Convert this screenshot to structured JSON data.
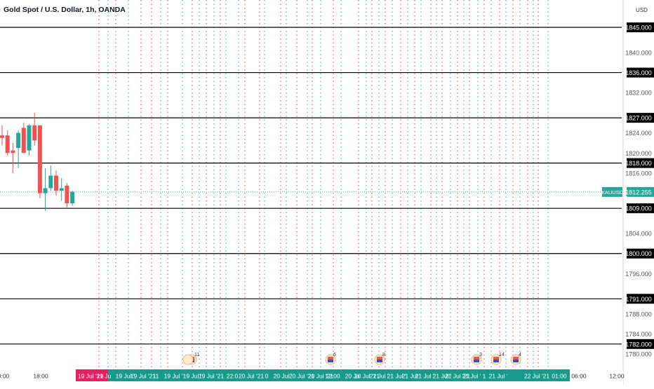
{
  "header": {
    "symbol_title": "Gold Spot / U.S. Dollar, 1h, OANDA",
    "currency": "USD"
  },
  "colors": {
    "up": "#26a69a",
    "down": "#ef5350",
    "red_line": "#e53935",
    "green_line": "#26a69a",
    "bar_green": "#199b8c",
    "bar_red": "#e91e63",
    "level_line": "#000000",
    "axis_text": "#555555"
  },
  "price_tag": {
    "symbol": "XAUUSD",
    "price": "1812.255",
    "value": 1812.255
  },
  "chart_data": {
    "type": "candlestick",
    "y_axis": {
      "range": [
        1778.5,
        1848.0
      ],
      "ticks": [
        1780,
        1784,
        1788,
        1792,
        1796,
        1800,
        1804,
        1808,
        1812,
        1816,
        1820,
        1824,
        1828,
        1832,
        1836,
        1840,
        1844
      ],
      "tick_labels": [
        "1780.000",
        "1784.000",
        "1788.000",
        "1792.000",
        "1796.000",
        "1800.000",
        "1804.000",
        "1808.000",
        "1812.000",
        "1816.000",
        "1820.000",
        "1824.000",
        "1828.000",
        "1832.000",
        "1836.000",
        "1840.000",
        "1844.000"
      ]
    },
    "levels": [
      {
        "value": 1845,
        "label": "1845.000"
      },
      {
        "value": 1836,
        "label": "1836.000"
      },
      {
        "value": 1827,
        "label": "1827.000"
      },
      {
        "value": 1818,
        "label": "1818.000"
      },
      {
        "value": 1809,
        "label": "1809.000"
      },
      {
        "value": 1800,
        "label": "1800.000"
      },
      {
        "value": 1791,
        "label": "1791.000"
      },
      {
        "value": 1782,
        "label": "1782.000"
      }
    ],
    "candles": [
      {
        "o": 1823.5,
        "h": 1825.5,
        "l": 1821.5,
        "c": 1823.0
      },
      {
        "o": 1823.5,
        "h": 1824.5,
        "l": 1819.5,
        "c": 1820.0
      },
      {
        "o": 1820.5,
        "h": 1822.0,
        "l": 1816.0,
        "c": 1820.0
      },
      {
        "o": 1821.0,
        "h": 1824.5,
        "l": 1817.0,
        "c": 1824.0
      },
      {
        "o": 1825.0,
        "h": 1826.0,
        "l": 1820.0,
        "c": 1820.0
      },
      {
        "o": 1820.5,
        "h": 1825.8,
        "l": 1819.5,
        "c": 1825.5
      },
      {
        "o": 1825.5,
        "h": 1828.0,
        "l": 1821.5,
        "c": 1822.5
      },
      {
        "o": 1825.5,
        "h": 1825.5,
        "l": 1811.0,
        "c": 1812.0
      },
      {
        "o": 1812.0,
        "h": 1817.0,
        "l": 1808.5,
        "c": 1813.0
      },
      {
        "o": 1813.0,
        "h": 1817.5,
        "l": 1812.5,
        "c": 1815.5
      },
      {
        "o": 1815.5,
        "h": 1816.5,
        "l": 1811.5,
        "c": 1812.5
      },
      {
        "o": 1812.5,
        "h": 1815.0,
        "l": 1810.5,
        "c": 1813.0
      },
      {
        "o": 1813.5,
        "h": 1814.0,
        "l": 1809.0,
        "c": 1810.0
      },
      {
        "o": 1810.0,
        "h": 1812.5,
        "l": 1809.5,
        "c": 1812.3
      }
    ],
    "time_labels": [
      {
        "text": "0:00",
        "kind": "plain"
      },
      {
        "text": "18:00",
        "kind": "plain"
      },
      {
        "text": "19 Jul '21",
        "kind": "red"
      },
      {
        "text": "19 Ju",
        "kind": "green"
      },
      {
        "text": "19 Jul '",
        "kind": "green"
      },
      {
        "text": "19 Jul '21",
        "kind": "green"
      },
      {
        "text": "11",
        "kind": "green"
      },
      {
        "text": "19 Jul '",
        "kind": "green"
      },
      {
        "text": "19 Jul '",
        "kind": "green"
      },
      {
        "text": "19 Jul '21",
        "kind": "green"
      },
      {
        "text": "22:0",
        "kind": "green"
      },
      {
        "text": "20 Jul '21",
        "kind": "green"
      },
      {
        "text": "0",
        "kind": "green"
      },
      {
        "text": "20 Jul '",
        "kind": "green"
      },
      {
        "text": "20 Jul '21",
        "kind": "green"
      },
      {
        "text": "20 Jul '21",
        "kind": "green"
      },
      {
        "text": "12:00",
        "kind": "green"
      },
      {
        "text": "20 Ju",
        "kind": "green"
      },
      {
        "text": "20 Jul '21",
        "kind": "green"
      },
      {
        "text": "21 Jul '",
        "kind": "green"
      },
      {
        "text": "21 Jul '",
        "kind": "green"
      },
      {
        "text": "21 Jul '",
        "kind": "green"
      },
      {
        "text": "21 Jul '",
        "kind": "green"
      },
      {
        "text": "21 Jul '",
        "kind": "green"
      },
      {
        "text": "21 Jul '21",
        "kind": "green"
      },
      {
        "text": "21 Jul '",
        "kind": "green"
      },
      {
        "text": "1",
        "kind": "green"
      },
      {
        "text": "21 Jul '",
        "kind": "green"
      },
      {
        "text": "22 Jul '21",
        "kind": "green"
      },
      {
        "text": "01:00",
        "kind": "green"
      },
      {
        "text": "06:00",
        "kind": "plain"
      },
      {
        "text": "12:00",
        "kind": "plain"
      }
    ],
    "events": [
      {
        "badge": "11"
      },
      {
        "badge": "6"
      },
      {
        "badge": "8"
      },
      {
        "badge": "3"
      },
      {
        "badge": "14"
      },
      {
        "badge": "4"
      }
    ]
  }
}
